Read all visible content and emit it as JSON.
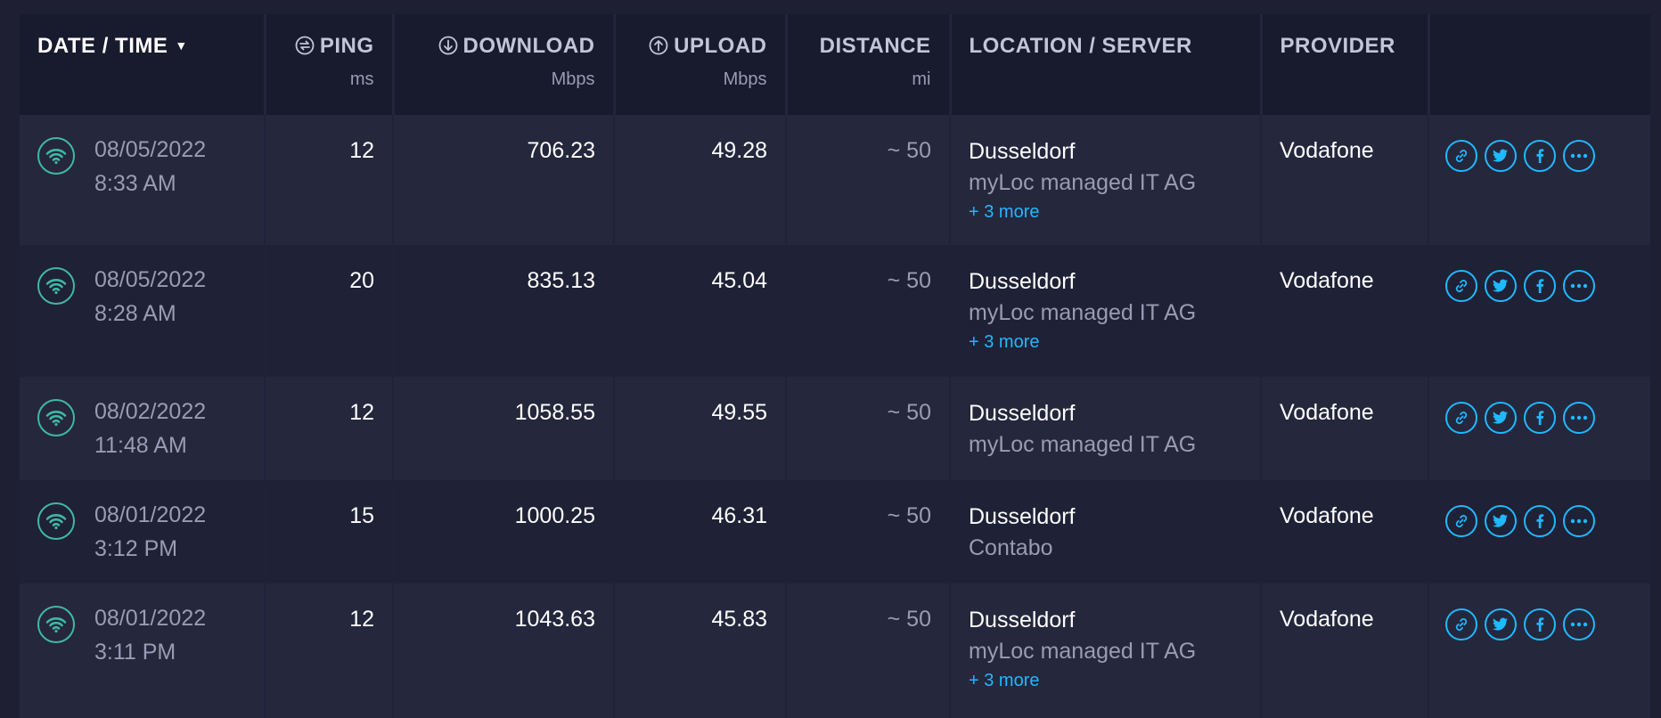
{
  "colors": {
    "background": "#1e1f33",
    "header_bg": "#181a2d",
    "row_alt": "#25273d",
    "accent_blue": "#1fb9ff",
    "wifi_teal": "#3fb8a8",
    "muted_text": "#9a9bb4"
  },
  "header": {
    "date_time": "DATE / TIME",
    "ping": "PING",
    "ping_unit": "ms",
    "download": "DOWNLOAD",
    "download_unit": "Mbps",
    "upload": "UPLOAD",
    "upload_unit": "Mbps",
    "distance": "DISTANCE",
    "distance_unit": "mi",
    "location": "LOCATION / SERVER",
    "provider": "PROVIDER"
  },
  "icons": {
    "sort": "sort-down-icon",
    "ping": "ping-icon",
    "download": "download-icon",
    "upload": "upload-icon",
    "wifi": "wifi-icon",
    "link": "link-icon",
    "twitter": "twitter-icon",
    "facebook": "facebook-icon",
    "more": "more-icon"
  },
  "rows": [
    {
      "date": "08/05/2022",
      "time": "8:33 AM",
      "ping": "12",
      "download": "706.23",
      "upload": "49.28",
      "distance": "~ 50",
      "city": "Dusseldorf",
      "server": "myLoc managed IT AG",
      "more": "+ 3 more",
      "provider": "Vodafone"
    },
    {
      "date": "08/05/2022",
      "time": "8:28 AM",
      "ping": "20",
      "download": "835.13",
      "upload": "45.04",
      "distance": "~ 50",
      "city": "Dusseldorf",
      "server": "myLoc managed IT AG",
      "more": "+ 3 more",
      "provider": "Vodafone"
    },
    {
      "date": "08/02/2022",
      "time": "11:48 AM",
      "ping": "12",
      "download": "1058.55",
      "upload": "49.55",
      "distance": "~ 50",
      "city": "Dusseldorf",
      "server": "myLoc managed IT AG",
      "more": "",
      "provider": "Vodafone"
    },
    {
      "date": "08/01/2022",
      "time": "3:12 PM",
      "ping": "15",
      "download": "1000.25",
      "upload": "46.31",
      "distance": "~ 50",
      "city": "Dusseldorf",
      "server": "Contabo",
      "more": "",
      "provider": "Vodafone"
    },
    {
      "date": "08/01/2022",
      "time": "3:11 PM",
      "ping": "12",
      "download": "1043.63",
      "upload": "45.83",
      "distance": "~ 50",
      "city": "Dusseldorf",
      "server": "myLoc managed IT AG",
      "more": "+ 3 more",
      "provider": "Vodafone"
    }
  ]
}
